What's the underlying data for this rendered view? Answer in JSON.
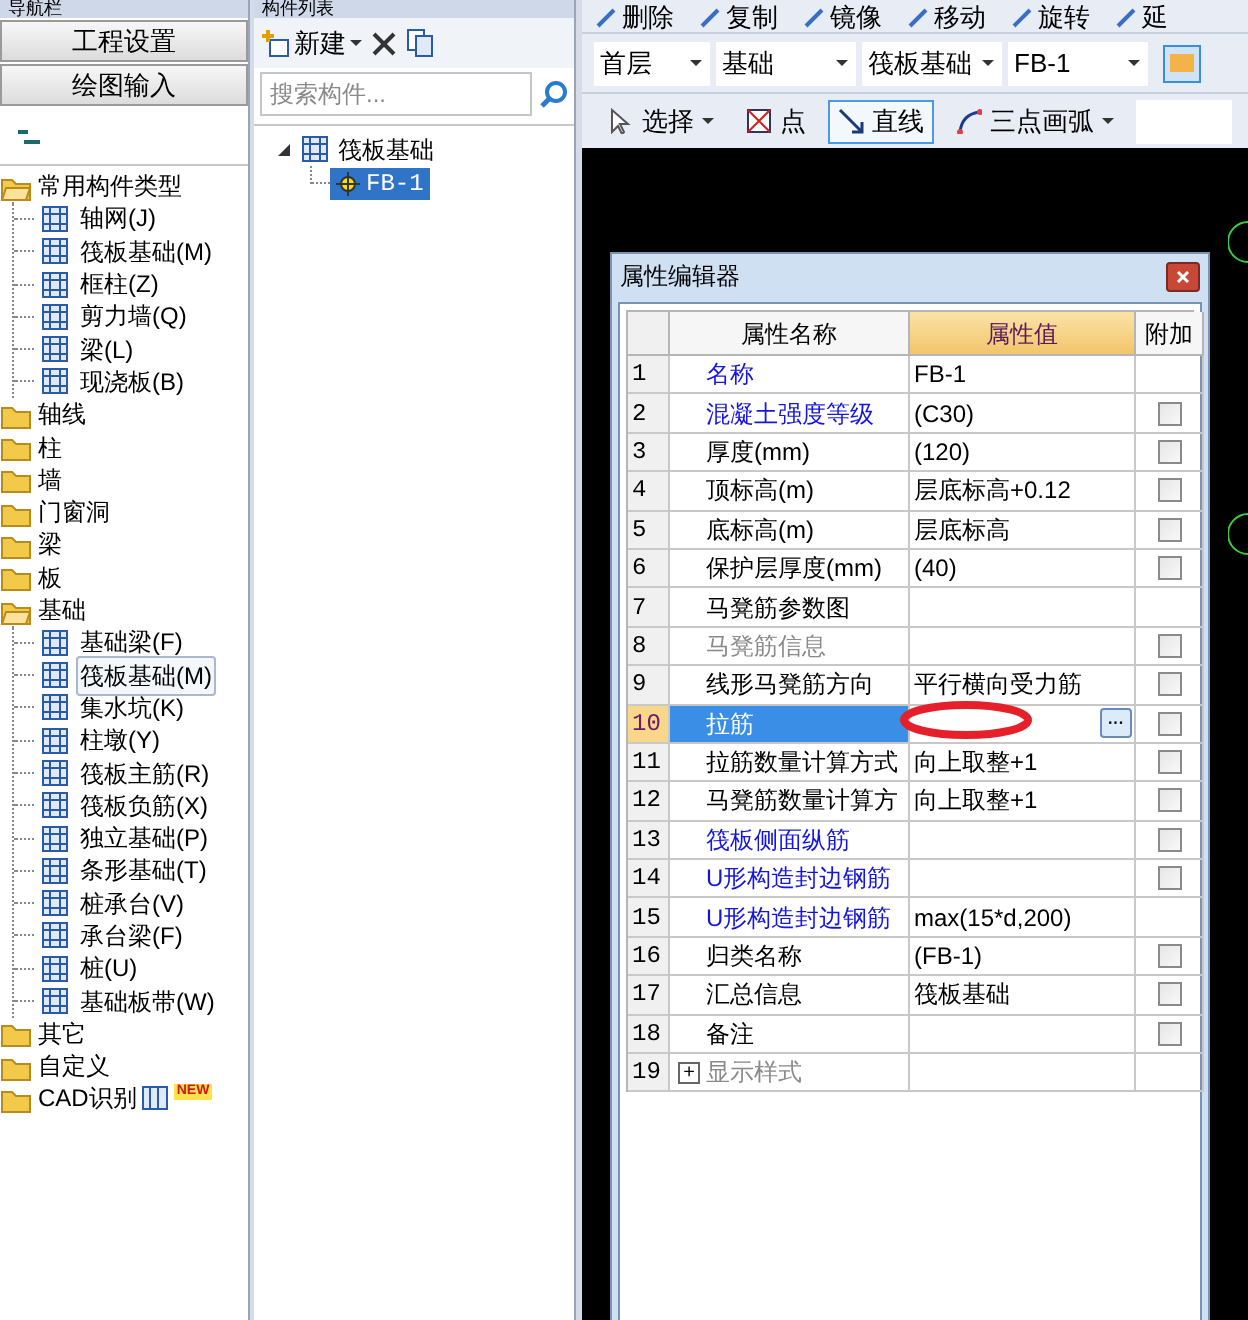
{
  "nav_panel": {
    "title": "导航栏",
    "buttons": [
      "工程设置",
      "绘图输入"
    ],
    "tree": [
      {
        "label": "常用构件类型",
        "kind": "folder",
        "expanded": true,
        "children": [
          {
            "label": "轴网(J)",
            "kind": "item",
            "selected": false
          },
          {
            "label": "筏板基础(M)",
            "kind": "item",
            "selected": false
          },
          {
            "label": "框柱(Z)",
            "kind": "item",
            "selected": false
          },
          {
            "label": "剪力墙(Q)",
            "kind": "item",
            "selected": false
          },
          {
            "label": "梁(L)",
            "kind": "item",
            "selected": false
          },
          {
            "label": "现浇板(B)",
            "kind": "item",
            "selected": false
          }
        ]
      },
      {
        "label": "轴线",
        "kind": "folder",
        "expanded": false
      },
      {
        "label": "柱",
        "kind": "folder",
        "expanded": false
      },
      {
        "label": "墙",
        "kind": "folder",
        "expanded": false
      },
      {
        "label": "门窗洞",
        "kind": "folder",
        "expanded": false
      },
      {
        "label": "梁",
        "kind": "folder",
        "expanded": false
      },
      {
        "label": "板",
        "kind": "folder",
        "expanded": false
      },
      {
        "label": "基础",
        "kind": "folder",
        "expanded": true,
        "children": [
          {
            "label": "基础梁(F)",
            "kind": "item",
            "selected": false
          },
          {
            "label": "筏板基础(M)",
            "kind": "item",
            "selected": true
          },
          {
            "label": "集水坑(K)",
            "kind": "item",
            "selected": false
          },
          {
            "label": "柱墩(Y)",
            "kind": "item",
            "selected": false
          },
          {
            "label": "筏板主筋(R)",
            "kind": "item",
            "selected": false
          },
          {
            "label": "筏板负筋(X)",
            "kind": "item",
            "selected": false
          },
          {
            "label": "独立基础(P)",
            "kind": "item",
            "selected": false
          },
          {
            "label": "条形基础(T)",
            "kind": "item",
            "selected": false
          },
          {
            "label": "桩承台(V)",
            "kind": "item",
            "selected": false
          },
          {
            "label": "承台梁(F)",
            "kind": "item",
            "selected": false
          },
          {
            "label": "桩(U)",
            "kind": "item",
            "selected": false
          },
          {
            "label": "基础板带(W)",
            "kind": "item",
            "selected": false
          }
        ]
      },
      {
        "label": "其它",
        "kind": "folder",
        "expanded": false
      },
      {
        "label": "自定义",
        "kind": "folder",
        "expanded": false
      },
      {
        "label": "CAD识别",
        "kind": "folder",
        "expanded": false,
        "badge": "NEW"
      }
    ]
  },
  "component_panel": {
    "title": "构件列表",
    "new_button": "新建",
    "search": {
      "placeholder": "搜索构件..."
    },
    "tree": [
      {
        "label": "筏板基础",
        "expanded": true,
        "children": [
          {
            "label": "FB-1",
            "selected": true
          }
        ]
      }
    ]
  },
  "edit_toolbar": [
    "删除",
    "复制",
    "镜像",
    "移动",
    "旋转",
    "延"
  ],
  "selectors": [
    "首层",
    "基础",
    "筏板基础",
    "FB-1"
  ],
  "draw_toolbar": [
    {
      "label": "选择",
      "selected": false,
      "dropdown": true
    },
    {
      "label": "点",
      "selected": false,
      "dropdown": false
    },
    {
      "label": "直线",
      "selected": true,
      "dropdown": false
    },
    {
      "label": "三点画弧",
      "selected": false,
      "dropdown": true
    }
  ],
  "property_editor": {
    "title": "属性编辑器",
    "columns": [
      "属性名称",
      "属性值",
      "附加"
    ],
    "rows": [
      {
        "num": "1",
        "name": "名称",
        "kind": "link",
        "value": "FB-1",
        "selected": false
      },
      {
        "num": "2",
        "name": "混凝土强度等级",
        "kind": "link",
        "value": "(C30)",
        "checked": false,
        "selected": false
      },
      {
        "num": "3",
        "name": "厚度(mm)",
        "kind": "normal",
        "value": "(120)",
        "checked": false,
        "selected": false
      },
      {
        "num": "4",
        "name": "顶标高(m)",
        "kind": "normal",
        "value": "层底标高+0.12",
        "checked": false,
        "selected": false
      },
      {
        "num": "5",
        "name": "底标高(m)",
        "kind": "normal",
        "value": "层底标高",
        "checked": false,
        "selected": false
      },
      {
        "num": "6",
        "name": "保护层厚度(mm)",
        "kind": "normal",
        "value": "(40)",
        "checked": false,
        "selected": false
      },
      {
        "num": "7",
        "name": "马凳筋参数图",
        "kind": "normal",
        "selected": false
      },
      {
        "num": "8",
        "name": "马凳筋信息",
        "kind": "disabled",
        "checked": false,
        "selected": false
      },
      {
        "num": "9",
        "name": "线形马凳筋方向",
        "kind": "normal",
        "value": "平行横向受力筋",
        "checked": false,
        "selected": false
      },
      {
        "num": "10",
        "name": "拉筋",
        "kind": "normal",
        "value_button": "···",
        "checked": false,
        "selected": true
      },
      {
        "num": "11",
        "name": "拉筋数量计算方式",
        "kind": "normal",
        "value": "向上取整+1",
        "checked": false,
        "selected": false
      },
      {
        "num": "12",
        "name": "马凳筋数量计算方",
        "kind": "normal",
        "value": "向上取整+1",
        "checked": false,
        "selected": false
      },
      {
        "num": "13",
        "name": "筏板侧面纵筋",
        "kind": "link",
        "checked": false,
        "selected": false
      },
      {
        "num": "14",
        "name": "U形构造封边钢筋",
        "kind": "link",
        "checked": false,
        "selected": false
      },
      {
        "num": "15",
        "name": "U形构造封边钢筋",
        "kind": "link",
        "value": "max(15*d,200)",
        "selected": false
      },
      {
        "num": "16",
        "name": "归类名称",
        "kind": "normal",
        "value": "(FB-1)",
        "checked": false,
        "selected": false
      },
      {
        "num": "17",
        "name": "汇总信息",
        "kind": "normal",
        "value": "筏板基础",
        "checked": false,
        "selected": false
      },
      {
        "num": "18",
        "name": "备注",
        "kind": "normal",
        "checked": false,
        "selected": false
      },
      {
        "num": "19",
        "name": "显示样式",
        "kind": "disabled",
        "expander": "+",
        "selected": false
      }
    ]
  }
}
